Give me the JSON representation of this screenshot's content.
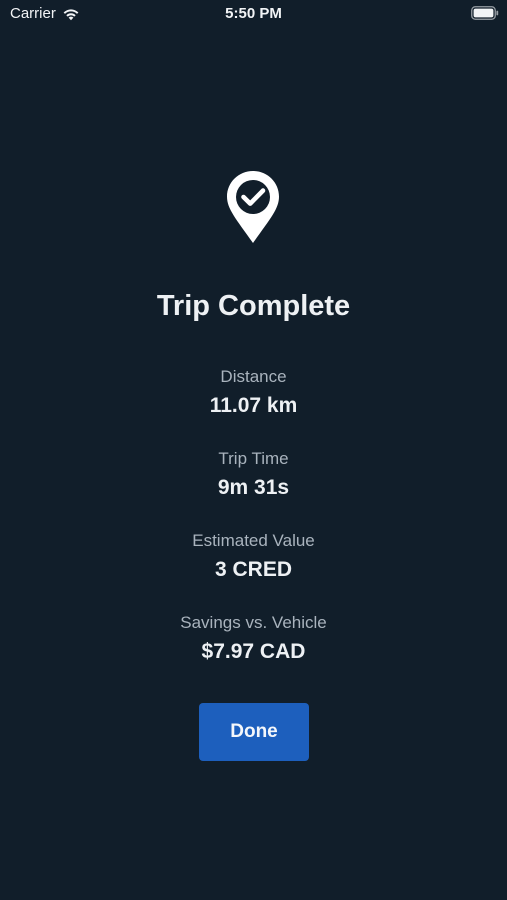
{
  "status_bar": {
    "carrier": "Carrier",
    "time": "5:50 PM",
    "icons": [
      "wifi-icon",
      "battery-icon"
    ]
  },
  "trip": {
    "icon": "map-pin-check-icon",
    "title": "Trip Complete",
    "stats": [
      {
        "label": "Distance",
        "value": "11.07 km"
      },
      {
        "label": "Trip Time",
        "value": "9m 31s"
      },
      {
        "label": "Estimated Value",
        "value": "3 CRED"
      },
      {
        "label": "Savings vs. Vehicle",
        "value": "$7.97 CAD"
      }
    ]
  },
  "actions": {
    "done_label": "Done"
  },
  "colors": {
    "background": "#111e2a",
    "text_primary": "#eef1f4",
    "text_secondary": "#a9b3bd",
    "accent": "#1d5fbd"
  }
}
